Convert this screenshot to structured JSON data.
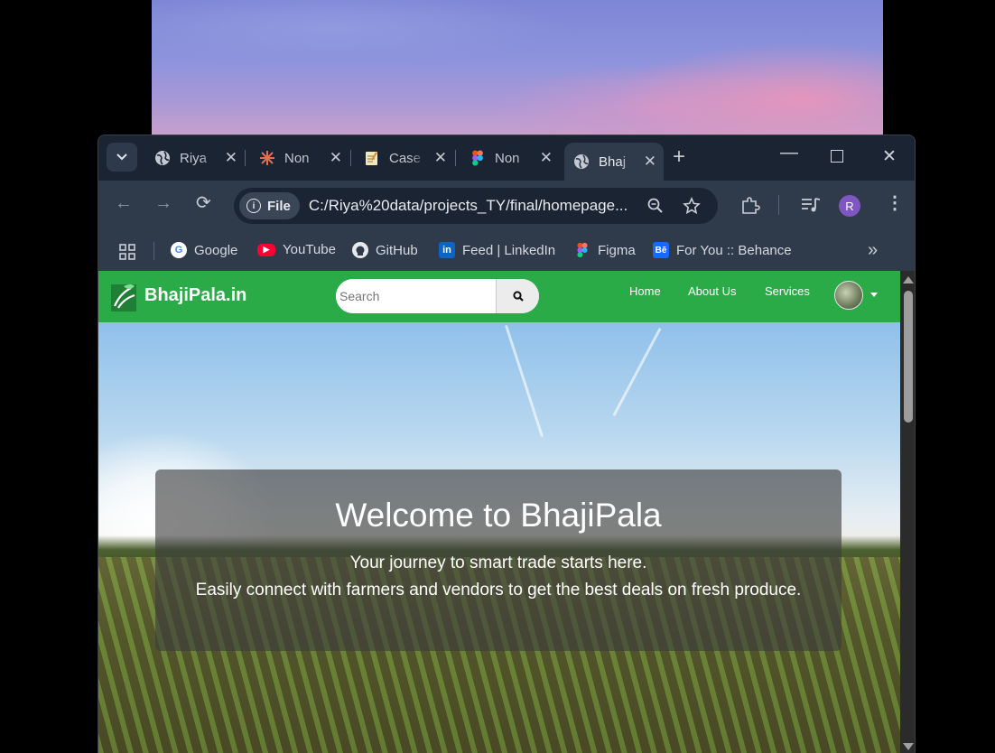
{
  "browser": {
    "tabs": [
      {
        "title": "Riya",
        "icon": "globe-icon"
      },
      {
        "title": "Non",
        "icon": "asterisk-icon"
      },
      {
        "title": "Case",
        "icon": "notepad-icon"
      },
      {
        "title": "Non",
        "icon": "figma-icon"
      },
      {
        "title": "Bhaj",
        "icon": "globe-icon",
        "active": true
      }
    ],
    "omnibox": {
      "chip_label": "File",
      "url": "C:/Riya%20data/projects_TY/final/homepage...",
      "profile_initial": "R"
    },
    "bookmarks": [
      {
        "label": "Google",
        "icon": "google-icon"
      },
      {
        "label": "YouTube",
        "icon": "youtube-icon"
      },
      {
        "label": "GitHub",
        "icon": "github-icon"
      },
      {
        "label": "Feed | LinkedIn",
        "icon": "linkedin-icon"
      },
      {
        "label": "Figma",
        "icon": "figma-icon"
      },
      {
        "label": "For You :: Behance",
        "icon": "behance-icon"
      }
    ],
    "colors": {
      "frame": "#1b2433",
      "toolbar": "#2f3a4a",
      "profile": "#7e57c2"
    }
  },
  "site": {
    "brand": "BhajiPala.in",
    "search_placeholder": "Search",
    "menu": [
      "Home",
      "About Us",
      "Services"
    ],
    "hero": {
      "title": "Welcome to BhajiPala",
      "line1": "Your journey to smart trade starts here.",
      "line2": "Easily connect with farmers and vendors to get the best deals on fresh produce."
    },
    "colors": {
      "navbar": "#2bab48"
    }
  }
}
